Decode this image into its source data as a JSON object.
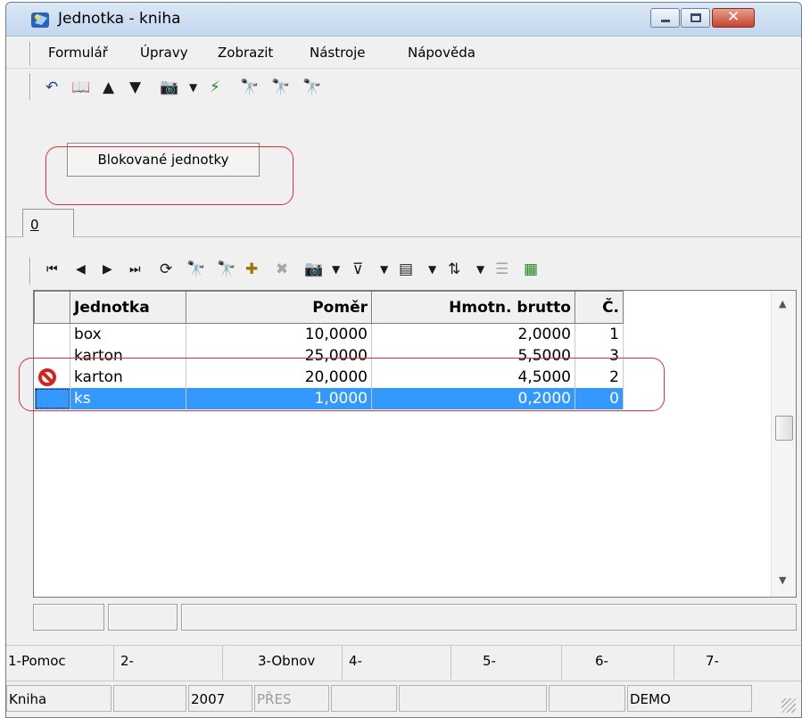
{
  "window": {
    "title": "Jednotka - kniha",
    "close_glyph": "✕"
  },
  "menu": [
    "Formulář",
    "Úpravy",
    "Zobrazit",
    "Nástroje",
    "Nápověda"
  ],
  "toolbar_icons": [
    "undo-icon",
    "book-icon",
    "arrow-up-icon",
    "arrow-down-icon",
    "camera-icon",
    "dropdown-icon",
    "filter-green-icon",
    "binoculars-icon",
    "binoculars-next-icon",
    "binoculars-prev-icon"
  ],
  "panel": {
    "button_label": "Blokované jednotky"
  },
  "tabs": [
    "0"
  ],
  "nav_icons": [
    "first-icon",
    "prev-icon",
    "next-icon",
    "last-icon",
    "refresh-icon",
    "find-icon",
    "find-disabled-icon",
    "add-icon",
    "delete-icon",
    "camera-icon",
    "filter-icon",
    "export-icon",
    "sort-icon",
    "list-icon",
    "excel-icon"
  ],
  "grid": {
    "columns": [
      "",
      "Jednotka",
      "Poměr",
      "Hmotn. brutto",
      "Č."
    ],
    "rows": [
      {
        "blocked": false,
        "selected": false,
        "jednotka": "box",
        "pomer": "10,0000",
        "brutto": "2,0000",
        "c": "1"
      },
      {
        "blocked": false,
        "selected": false,
        "jednotka": "karton",
        "pomer": "25,0000",
        "brutto": "5,5000",
        "c": "3"
      },
      {
        "blocked": true,
        "selected": false,
        "jednotka": "karton",
        "pomer": "20,0000",
        "brutto": "4,5000",
        "c": "2"
      },
      {
        "blocked": false,
        "selected": true,
        "jednotka": "ks",
        "pomer": "1,0000",
        "brutto": "0,2000",
        "c": "0"
      }
    ]
  },
  "fkeys": [
    "1-Pomoc",
    "2-",
    "3-Obnov",
    "4-",
    "5-",
    "6-",
    "7-"
  ],
  "status": [
    "Kniha",
    "",
    "2007",
    "PŘES",
    "",
    "",
    "",
    "DEMO"
  ],
  "colors": {
    "selection": "#3399ff",
    "highlight": "#e0303a",
    "blocked": "#d6231e"
  }
}
